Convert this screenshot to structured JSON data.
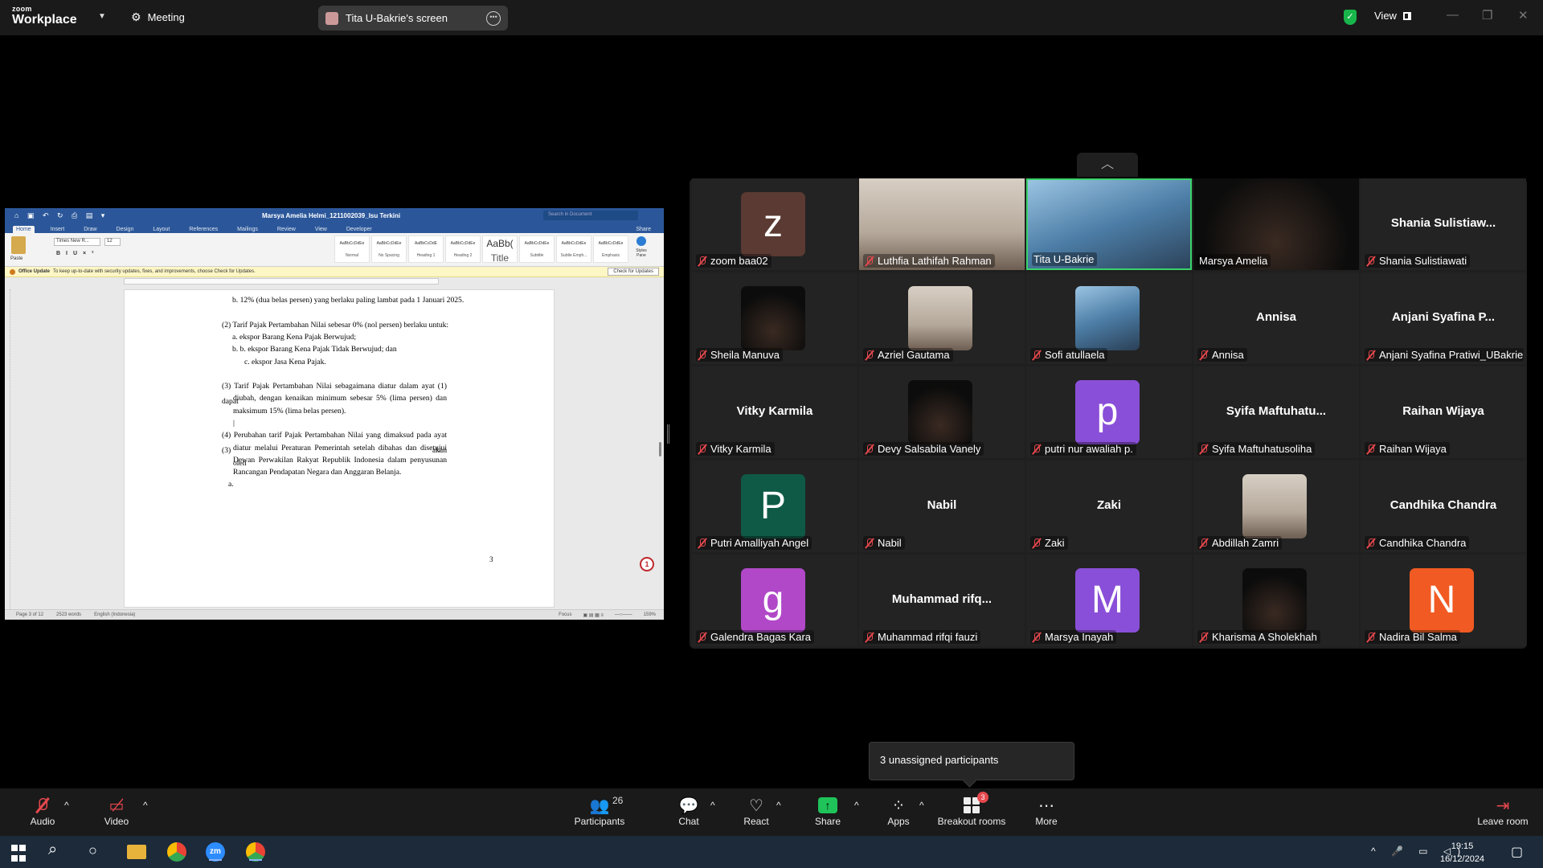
{
  "topbar": {
    "brand_line1": "zoom",
    "brand_line2": "Workplace",
    "meeting_label": "Meeting",
    "screen_label": "Tita U-Bakrie's screen",
    "view_label": "View"
  },
  "document": {
    "title": "Marsya Amelia Helmi_1211002039_Isu Terkini",
    "search_placeholder": "Search in Document",
    "share_label": "Share",
    "tabs": [
      "Home",
      "Insert",
      "Draw",
      "Design",
      "Layout",
      "References",
      "Mailings",
      "Review",
      "View",
      "Developer"
    ],
    "font_name": "Times New R...",
    "font_size": "12",
    "paste_label": "Paste",
    "styles": [
      {
        "sample": "AaBbCcDdEe",
        "name": "Normal"
      },
      {
        "sample": "AaBbCcDdEe",
        "name": "No Spacing"
      },
      {
        "sample": "AaBbCcDdE",
        "name": "Heading 1"
      },
      {
        "sample": "AaBbCcDdEe",
        "name": "Heading 2"
      },
      {
        "sample": "AaBb(",
        "name": "Title"
      },
      {
        "sample": "AaBbCcDdEe",
        "name": "Subtitle"
      },
      {
        "sample": "AaBbCcDdEe",
        "name": "Subtle Emph..."
      },
      {
        "sample": "AaBbCcDdEe",
        "name": "Emphasis"
      }
    ],
    "styles_pane": "Styles Pane",
    "update_title": "Office Update",
    "update_text": "To keep up-to-date with security updates, fixes, and improvements, choose Check for Updates.",
    "update_button": "Check for Updates",
    "lines": {
      "b12": "b. 12% (dua belas persen) yang berlaku paling lambat pada 1 Januari 2025.",
      "p2": "(2) Tarif Pajak Pertambahan Nilai sebesar 0% (nol persen) berlaku untuk:",
      "p2a": "a.   ekspor Barang Kena Pajak Berwujud;",
      "p2b": "b.   b. ekspor Barang Kena Pajak Tidak Berwujud; dan",
      "p2c": "c. ekspor Jasa Kena Pajak.",
      "p3_1": "(3) Tarif Pajak Pertambahan Nilai sebagaimana diatur dalam ayat (1) dapat",
      "p3_2": "diubah, dengan kenaikan minimum sebesar 5% (lima persen) dan",
      "p3_3": "maksimum 15% (lima belas persen).",
      "p4_1": "(4) Perubahan tarif Pajak Pertambahan Nilai yang dimaksud pada ayat (3) akan",
      "p4_2": "diatur melalui Peraturan Pemerintah setelah dibahas dan disetujui oleh",
      "p4_3": "Dewan Perwakilan Rakyat Republik Indonesia dalam penyusunan",
      "p4_4": "Rancangan Pendapatan Negara dan Anggaran Belanja.",
      "p4a": "a."
    },
    "page_number": "3",
    "status_page": "Page 3 of 12",
    "status_words": "2523 words",
    "status_lang": "English (Indonesia)",
    "status_focus": "Focus",
    "status_zoom": "159%",
    "comment_count": "1"
  },
  "participants": [
    {
      "name": "zoom baa02",
      "avatar": "z",
      "color": "#5a3a32"
    },
    {
      "name": "Luthfia Lathifah Rahman",
      "photo": true
    },
    {
      "name": "Tita U-Bakrie",
      "photo": true,
      "speaking": true
    },
    {
      "name": "Marsya Amelia",
      "photo": true
    },
    {
      "name": "Shania Sulistiawati",
      "big": "Shania  Sulistiaw..."
    },
    {
      "name": "Sheila Manuva",
      "photo": true
    },
    {
      "name": "Azriel Gautama",
      "photo": true
    },
    {
      "name": "Sofi atullaela",
      "photo": true
    },
    {
      "name": "Annisa",
      "big": "Annisa"
    },
    {
      "name": "Anjani Syafina Pratiwi_UBakrie",
      "big": "Anjani  Syafina  P..."
    },
    {
      "name": "Vitky Karmila",
      "big": "Vitky  Karmila"
    },
    {
      "name": "Devy Salsabila Vanely",
      "photo": true
    },
    {
      "name": "putri nur awaliah p.",
      "avatar": "p",
      "color": "#8a4fd8"
    },
    {
      "name": "Syifa Maftuhatusoliha",
      "big": "Syifa  Maftuhatu..."
    },
    {
      "name": "Raihan Wijaya",
      "big": "Raihan  Wijaya"
    },
    {
      "name": "Putri Amalliyah Angel",
      "avatar": "P",
      "color": "#0f5a46"
    },
    {
      "name": "Nabil",
      "big": "Nabil"
    },
    {
      "name": "Zaki",
      "big": "Zaki"
    },
    {
      "name": "Abdillah Zamri",
      "photo": true
    },
    {
      "name": "Candhika Chandra",
      "big": "Candhika  Chandra"
    },
    {
      "name": "Galendra Bagas Kara",
      "avatar": "g",
      "color": "#b048c8"
    },
    {
      "name": "Muhammad rifqi fauzi",
      "big": "Muhammad  rifq..."
    },
    {
      "name": "Marsya Inayah",
      "avatar": "M",
      "color": "#8a4fd8"
    },
    {
      "name": "Kharisma A Sholekhah",
      "photo": true
    },
    {
      "name": "Nadira Bil Salma",
      "avatar": "N",
      "color": "#f15a22"
    }
  ],
  "tooltip": "3 unassigned participants",
  "toolbar": {
    "audio": "Audio",
    "video": "Video",
    "participants": "Participants",
    "participants_count": "26",
    "chat": "Chat",
    "react": "React",
    "share": "Share",
    "apps": "Apps",
    "breakout": "Breakout rooms",
    "breakout_badge": "3",
    "more": "More",
    "leave": "Leave room"
  },
  "taskbar": {
    "time": "19:15",
    "date": "16/12/2024"
  }
}
